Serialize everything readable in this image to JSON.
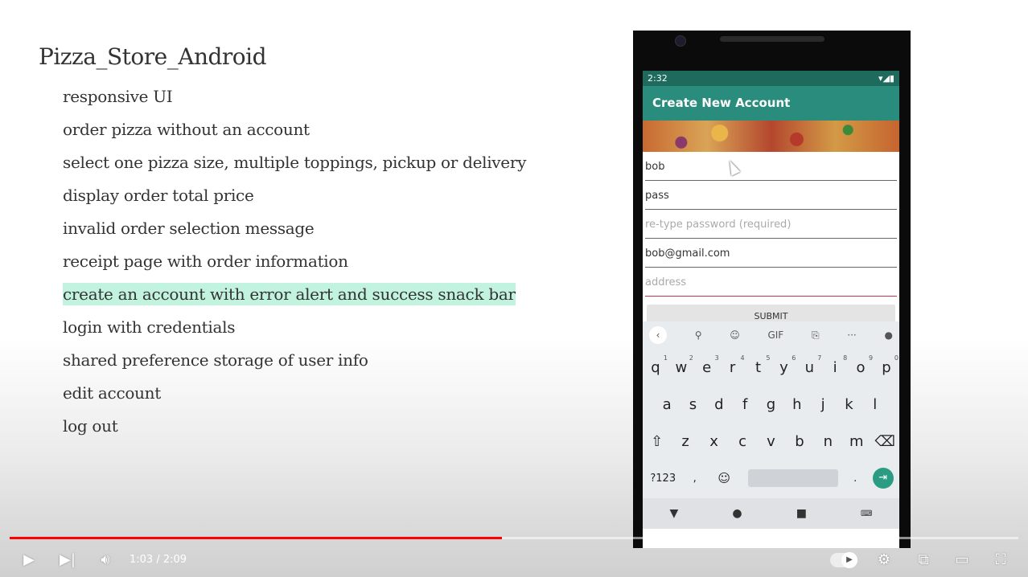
{
  "slide": {
    "title": "Pizza_Store_Android",
    "features": [
      "responsive UI",
      "order pizza without an account",
      "select one pizza size, multiple toppings, pickup or delivery",
      "display order total price",
      "invalid order selection message",
      "receipt page with order information",
      "create an account with error alert and success snack bar",
      "login with credentials",
      "shared preference storage of user info",
      "edit account",
      "log out"
    ],
    "highlighted_index": 6,
    "highlight_color": "#c2f3df"
  },
  "phone": {
    "status_time": "2:32",
    "appbar_title": "Create New Account",
    "appbar_color": "#2a8c7c",
    "fields": {
      "username": "bob",
      "password": "pass",
      "retype_placeholder": "re-type password (required)",
      "email": "bob@gmail.com",
      "address_placeholder": "address"
    },
    "submit_label": "SUBMIT",
    "keyboard": {
      "toolbar": [
        "<",
        "search-icon",
        "sticker-icon",
        "GIF",
        "translate-icon",
        "...",
        "mic-icon"
      ],
      "row1": [
        "q",
        "w",
        "e",
        "r",
        "t",
        "y",
        "u",
        "i",
        "o",
        "p"
      ],
      "row1_hints": [
        "1",
        "2",
        "3",
        "4",
        "5",
        "6",
        "7",
        "8",
        "9",
        "0"
      ],
      "row2": [
        "a",
        "s",
        "d",
        "f",
        "g",
        "h",
        "j",
        "k",
        "l"
      ],
      "row3": [
        "z",
        "x",
        "c",
        "v",
        "b",
        "n",
        "m"
      ],
      "symbols_key": "?123",
      "comma": ",",
      "period": "."
    }
  },
  "player": {
    "current_time": "1:03",
    "duration": "2:09",
    "time_display": "1:03 / 2:09",
    "progress_fraction": 0.488,
    "progress_color": "#ff0000"
  }
}
